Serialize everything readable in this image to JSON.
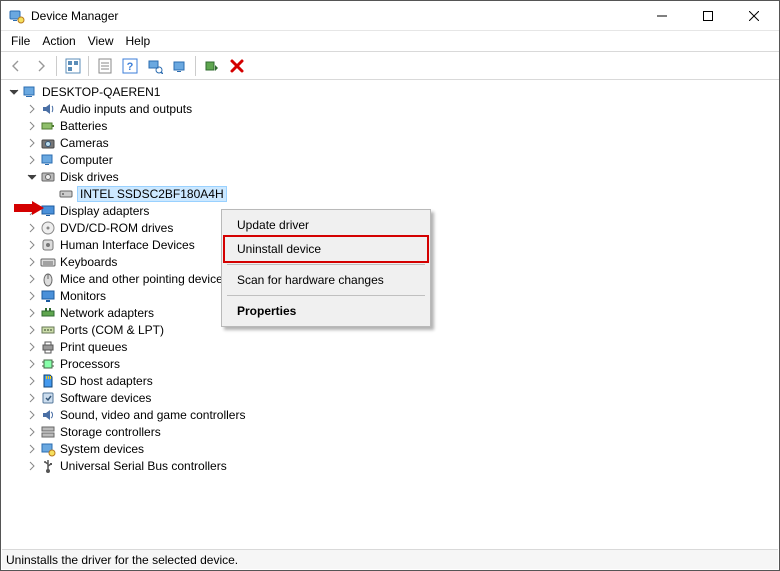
{
  "window": {
    "title": "Device Manager"
  },
  "menubar": {
    "items": [
      "File",
      "Action",
      "View",
      "Help"
    ]
  },
  "toolbar": {
    "back": "Back",
    "forward": "Forward"
  },
  "tree": {
    "root": "DESKTOP-QAEREN1",
    "categories": [
      {
        "label": "Audio inputs and outputs",
        "icon": "audio"
      },
      {
        "label": "Batteries",
        "icon": "battery"
      },
      {
        "label": "Cameras",
        "icon": "camera"
      },
      {
        "label": "Computer",
        "icon": "computer"
      },
      {
        "label": "Disk drives",
        "icon": "disk",
        "expanded": true,
        "children": [
          {
            "label": "INTEL SSDSC2BF180A4H",
            "icon": "drive",
            "selected": true
          }
        ]
      },
      {
        "label": "Display adapters",
        "icon": "display"
      },
      {
        "label": "DVD/CD-ROM drives",
        "icon": "dvd"
      },
      {
        "label": "Human Interface Devices",
        "icon": "hid"
      },
      {
        "label": "Keyboards",
        "icon": "keyboard"
      },
      {
        "label": "Mice and other pointing devices",
        "icon": "mouse"
      },
      {
        "label": "Monitors",
        "icon": "monitor"
      },
      {
        "label": "Network adapters",
        "icon": "network"
      },
      {
        "label": "Ports (COM & LPT)",
        "icon": "ports"
      },
      {
        "label": "Print queues",
        "icon": "printer"
      },
      {
        "label": "Processors",
        "icon": "cpu"
      },
      {
        "label": "SD host adapters",
        "icon": "sd"
      },
      {
        "label": "Software devices",
        "icon": "software"
      },
      {
        "label": "Sound, video and game controllers",
        "icon": "sound"
      },
      {
        "label": "Storage controllers",
        "icon": "storage"
      },
      {
        "label": "System devices",
        "icon": "system"
      },
      {
        "label": "Universal Serial Bus controllers",
        "icon": "usb"
      }
    ]
  },
  "context_menu": {
    "update": "Update driver",
    "uninstall": "Uninstall device",
    "scan": "Scan for hardware changes",
    "properties": "Properties"
  },
  "statusbar": {
    "text": "Uninstalls the driver for the selected device."
  }
}
